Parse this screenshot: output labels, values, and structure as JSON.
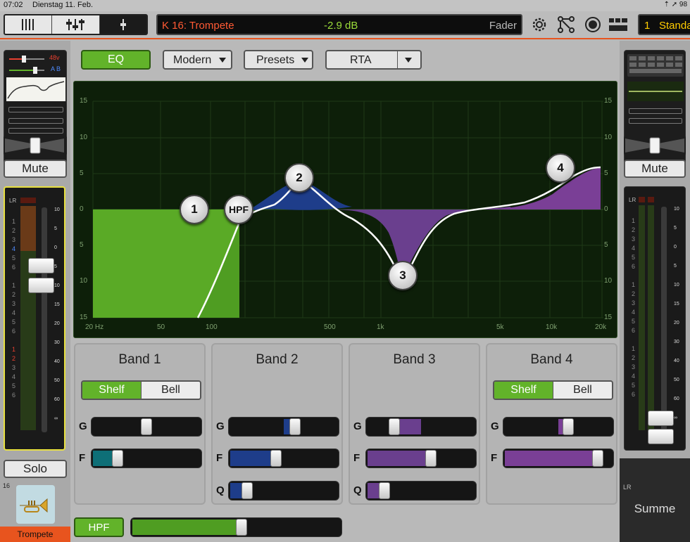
{
  "status": {
    "time": "07:02",
    "date": "Dienstag 11. Feb.",
    "icons_text": "⇡ ➚ 98"
  },
  "top": {
    "channel_name": "K 16: Trompete",
    "level": "-2.9 dB",
    "mode": "Fader",
    "scene_number": "1",
    "scene_name": "Standa"
  },
  "left_strip": {
    "phantom": "48v",
    "ab": "A  B",
    "mute": "Mute",
    "solo": "Solo",
    "meter_label": "LR",
    "channel_number": "16",
    "channel_name": "Trompete",
    "meter_digits": [
      "1",
      "2",
      "3",
      "4",
      "5",
      "6",
      "",
      "1",
      "2",
      "3",
      "4",
      "5",
      "6",
      "",
      "1",
      "2",
      "3",
      "4",
      "5",
      "6"
    ],
    "scale": [
      "10",
      "5",
      "0",
      "5",
      "10",
      "15",
      "20",
      "30",
      "40",
      "50",
      "60",
      "∞"
    ]
  },
  "right_strip": {
    "mute": "Mute",
    "meter_label": "LR",
    "name": "Summe",
    "meter_digits": [
      "1",
      "2",
      "3",
      "4",
      "5",
      "6",
      "",
      "1",
      "2",
      "3",
      "4",
      "5",
      "6",
      "",
      "1",
      "2",
      "3",
      "4",
      "5",
      "6"
    ],
    "scale": [
      "10",
      "5",
      "0",
      "5",
      "10",
      "15",
      "20",
      "30",
      "40",
      "50",
      "60",
      "∞"
    ]
  },
  "toolbar": {
    "eq_label": "EQ",
    "mode_label": "Modern",
    "presets_label": "Presets",
    "rta_label": "RTA"
  },
  "eq_graph": {
    "y_labels": [
      "15",
      "10",
      "5",
      "0",
      "5",
      "10",
      "15"
    ],
    "x_labels": [
      "20 Hz",
      "50",
      "100",
      "500",
      "1k",
      "5k",
      "10k",
      "20k"
    ],
    "nodes": [
      "1",
      "HPF",
      "2",
      "3",
      "4"
    ]
  },
  "bands": [
    {
      "title": "Band 1",
      "type_a": "Shelf",
      "type_b": "Bell",
      "g": "G",
      "f": "F",
      "gain": 0.5,
      "freq": 0.2
    },
    {
      "title": "Band 2",
      "g": "G",
      "f": "F",
      "q": "Q",
      "gain": 0.62,
      "freq": 0.42,
      "qv": 0.12
    },
    {
      "title": "Band 3",
      "g": "G",
      "f": "F",
      "q": "Q",
      "gain": 0.22,
      "freq": 0.6,
      "qv": 0.12
    },
    {
      "title": "Band 4",
      "type_a": "Shelf",
      "type_b": "Bell",
      "g": "G",
      "f": "F",
      "gain": 0.6,
      "freq": 0.91
    }
  ],
  "hpf": {
    "label": "HPF",
    "level": 0.55
  },
  "colors": {
    "green": "#62b32a",
    "blue": "#1e3d8a",
    "purple": "#6a3f8e",
    "accent": "#e8541e",
    "teal": "#0e6f77"
  }
}
